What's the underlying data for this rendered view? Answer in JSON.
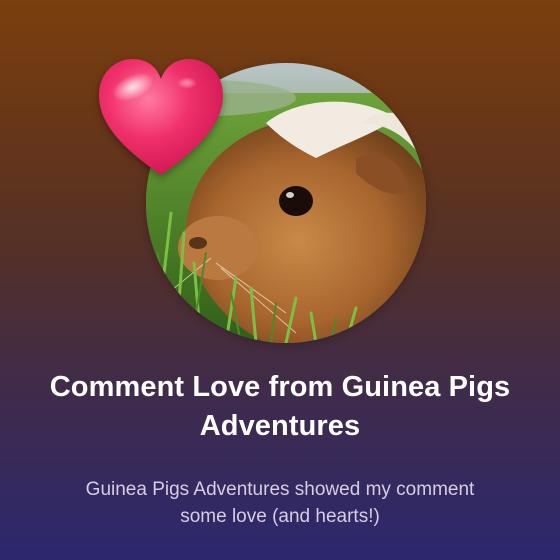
{
  "card": {
    "title": "Comment Love from Guinea Pigs Adventures",
    "subtitle": "Guinea Pigs Adventures showed my comment some love (and hearts!)"
  },
  "icons": {
    "heart": "heart-icon",
    "avatar": "guinea-pig-photo"
  },
  "colors": {
    "gradient_top": "#7a3f0e",
    "gradient_bottom": "#2c286f",
    "heart": "#f0306a",
    "title_text": "#ffffff",
    "subtitle_text": "#d9cde0"
  }
}
